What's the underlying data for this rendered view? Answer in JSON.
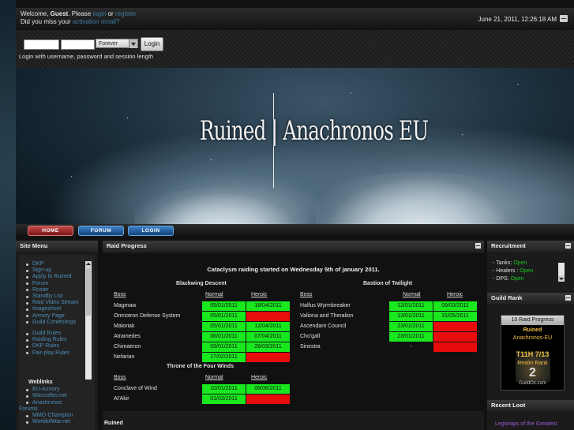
{
  "colors": {
    "link": "#4d8fb8",
    "cleared": "#19e81f",
    "not_cleared": "#e80c0c",
    "open": "#19c819",
    "epic": "#9a5bd8"
  },
  "topbar": {
    "welcome": "Welcome, ",
    "guest": "Guest",
    "please": ". Please",
    "login_link": "login",
    "or": "or",
    "register_link": "register",
    "missed": "Did you miss your",
    "activation_link": "activation email?",
    "datetime": "June 21, 2011, 12:26:18 AM"
  },
  "login": {
    "session_length": "Forever",
    "button": "Login",
    "hint": "Login with username, password and session length"
  },
  "banner": {
    "title": "Ruined | Anachronos EU"
  },
  "nav": {
    "home": "HOME",
    "forum": "FORUM",
    "login": "LOGIN"
  },
  "site_menu": {
    "title": "Site Menu",
    "items": [
      "DKP",
      "Sign-up",
      "Apply to Ruined",
      "Forum",
      "Roster",
      "Standby List",
      "Raid Video Stream",
      "Imageshost",
      "Armory Page",
      "Guild Contestings"
    ],
    "items2": [
      "Guild Rules",
      "Raiding Rules",
      "DKP Rules",
      "Fair-play Rules"
    ],
    "weblinks_title": "Weblinks",
    "weblinks": [
      "EU-Armory",
      "Warcrafter.net",
      "Anachronos",
      "Forums",
      "MMO-Champion",
      "WorldofWar.net"
    ]
  },
  "raid": {
    "title": "Raid Progress",
    "headline": "Cataclysm raiding started on Wednesday 5th of january 2011.",
    "col_boss": "Boss",
    "col_normal": "Normal",
    "col_heroic": "Heroic",
    "bwd": {
      "name": "Blackwing Descent",
      "rows": [
        {
          "boss": "Magmaw",
          "normal": "05/01/2011",
          "heroic": "18/04/2011"
        },
        {
          "boss": "Omnotron Defense System",
          "normal": "05/01/2011",
          "heroic": ""
        },
        {
          "boss": "Maloriak",
          "normal": "05/01/2011",
          "heroic": "12/04/2011"
        },
        {
          "boss": "Atramedes",
          "normal": "06/01/2011",
          "heroic": "07/04/2011"
        },
        {
          "boss": "Chimaeron",
          "normal": "09/01/2011",
          "heroic": "28/03/2011"
        },
        {
          "boss": "Nefarian",
          "normal": "17/02/2011",
          "heroic": ""
        }
      ]
    },
    "bot": {
      "name": "Bastion of Twilight",
      "rows": [
        {
          "boss": "Halfus Wyrmbreaker",
          "normal": "12/01/2011",
          "heroic": "09/03/2011"
        },
        {
          "boss": "Valiona and Theralion",
          "normal": "13/01/2011",
          "heroic": "31/05/2011"
        },
        {
          "boss": "Ascendant Council",
          "normal": "23/01/2011",
          "heroic": ""
        },
        {
          "boss": "Cho'gall",
          "normal": "23/01/2011",
          "heroic": ""
        },
        {
          "boss": "Sinestra",
          "normal": "-",
          "heroic": ""
        }
      ]
    },
    "tfw": {
      "name": "Throne of the Four Winds",
      "rows": [
        {
          "boss": "Conclave of Wind",
          "normal": "10/01/2011",
          "heroic": "08/06/2011"
        },
        {
          "boss": "Al'Akir",
          "normal": "01/03/2011",
          "heroic": ""
        }
      ]
    },
    "footer": "Ruined"
  },
  "recruitment": {
    "title": "Recruitment",
    "rows": [
      {
        "role": "- Tanks: ",
        "status": "Open"
      },
      {
        "role": "- Healers : ",
        "status": "Open"
      },
      {
        "role": "- DPS: ",
        "status": "Open"
      }
    ]
  },
  "guild_rank": {
    "title": "Guild Rank",
    "widget_title": "10 Raid Progress",
    "guild": "Ruined",
    "realm": "Anachronos-EU",
    "tier": "T11H 7/13",
    "mode": "Realm Rank",
    "rank": "2",
    "footer": "GuildOx.com"
  },
  "recent_loot": {
    "title": "Recent Loot",
    "item": "Legwraps of the Greatest"
  }
}
